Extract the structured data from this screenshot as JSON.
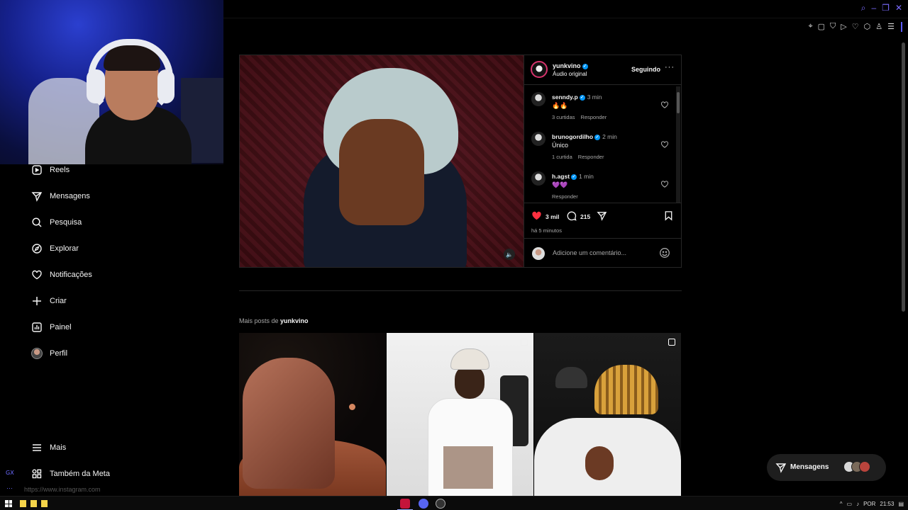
{
  "browser": {
    "status_url": "https://www.instagram.com",
    "gx_label": "GX",
    "rail_dots": "···"
  },
  "nav": {
    "items": [
      {
        "label": "Reels",
        "icon": "reels-icon"
      },
      {
        "label": "Mensagens",
        "icon": "paper-plane-icon"
      },
      {
        "label": "Pesquisa",
        "icon": "search-icon"
      },
      {
        "label": "Explorar",
        "icon": "compass-icon"
      },
      {
        "label": "Notificações",
        "icon": "heart-icon"
      },
      {
        "label": "Criar",
        "icon": "plus-icon"
      },
      {
        "label": "Painel",
        "icon": "chart-icon"
      },
      {
        "label": "Perfil",
        "icon": "avatar"
      }
    ],
    "more": "Mais",
    "meta": "Também da Meta"
  },
  "post": {
    "author": "yunkvino",
    "audio": "Áudio original",
    "follow_label": "Seguindo",
    "more_label": "···",
    "comments": [
      {
        "user": "senndy.p",
        "time": "3 min",
        "text": "🔥🔥",
        "likes": "3 curtidas",
        "reply": "Responder"
      },
      {
        "user": "brunogordilho",
        "time": "2 min",
        "text": "Único",
        "likes": "1 curtida",
        "reply": "Responder"
      },
      {
        "user": "h.agst",
        "time": "1 min",
        "text": "💜💜",
        "likes": "",
        "reply": "Responder"
      }
    ],
    "likes": "3 mil",
    "comments_count": "215",
    "time_ago": "há 5 minutos",
    "comment_placeholder": "Adicione um comentário...",
    "mute_icon": "🔈"
  },
  "more_posts": {
    "prefix": "Mais posts de ",
    "author": "yunkvino"
  },
  "messages_pill": {
    "label": "Mensagens"
  },
  "taskbar": {
    "lang": "POR",
    "time": "21:53"
  },
  "colors": {
    "like_red": "#ff3040",
    "verified_blue": "#0095f6",
    "accent_purple": "#7b6bff"
  }
}
